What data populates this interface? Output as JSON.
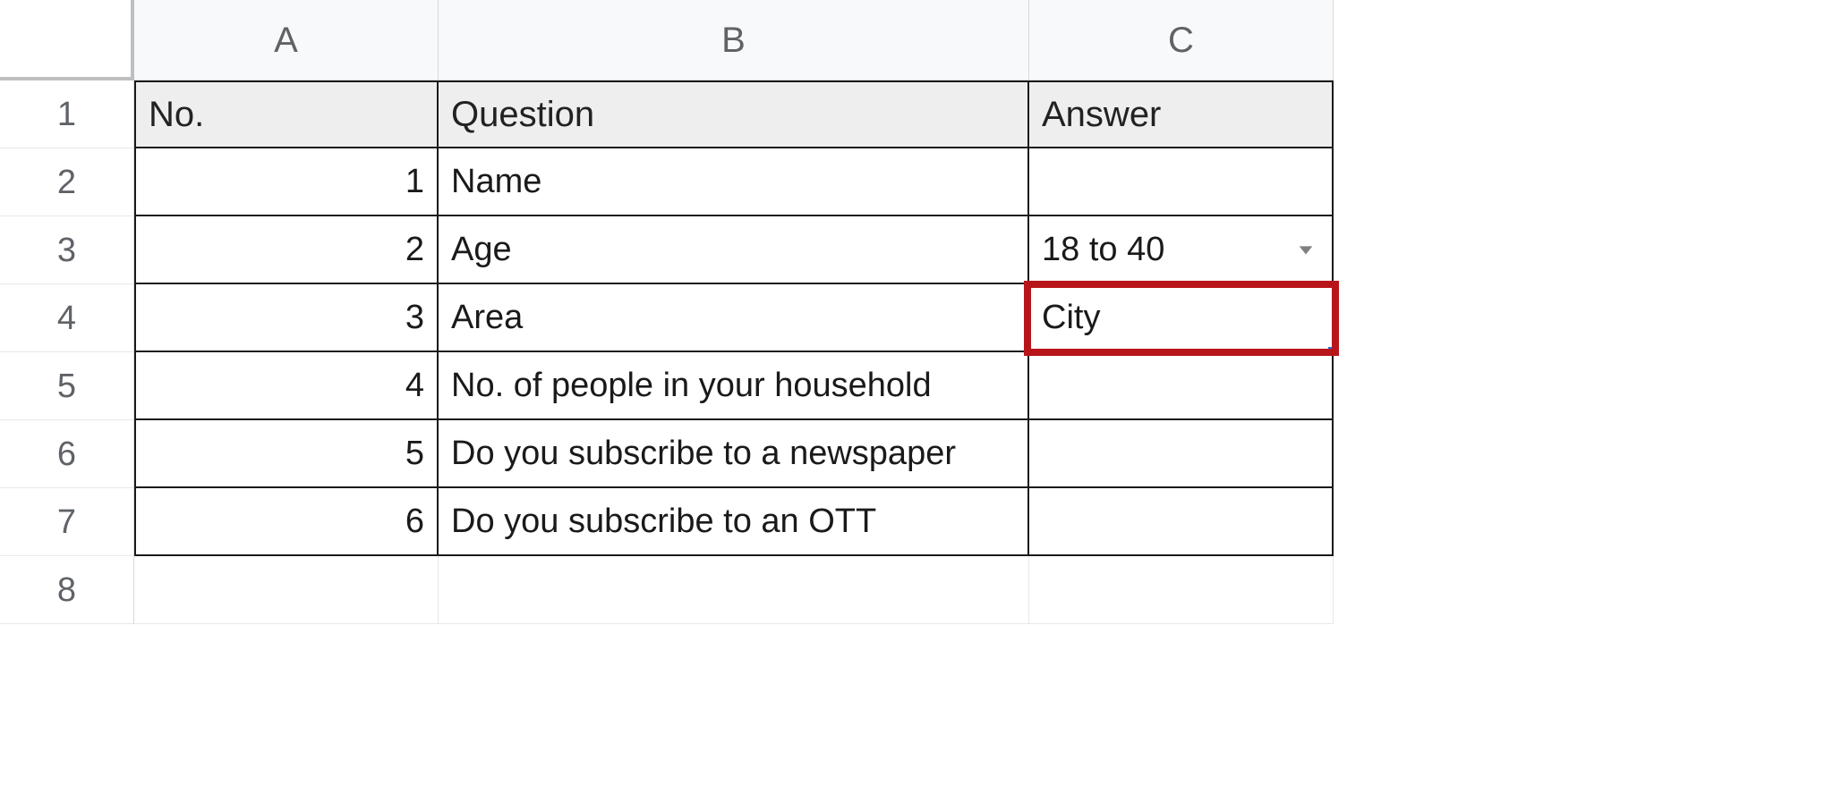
{
  "columns": {
    "A": "A",
    "B": "B",
    "C": "C"
  },
  "row_numbers": [
    "1",
    "2",
    "3",
    "4",
    "5",
    "6",
    "7",
    "8"
  ],
  "table": {
    "header": {
      "A": "No.",
      "B": "Question",
      "C": "Answer"
    },
    "rows": [
      {
        "no": "1",
        "question": "Name",
        "answer": ""
      },
      {
        "no": "2",
        "question": "Age",
        "answer": "18 to 40",
        "dropdown": true
      },
      {
        "no": "3",
        "question": "Area",
        "answer": "City",
        "selected": true,
        "annotated": true
      },
      {
        "no": "4",
        "question": "No. of people in your household",
        "answer": ""
      },
      {
        "no": "5",
        "question": "Do you subscribe to a newspaper",
        "answer": ""
      },
      {
        "no": "6",
        "question": "Do you subscribe to an OTT",
        "answer": ""
      }
    ]
  }
}
